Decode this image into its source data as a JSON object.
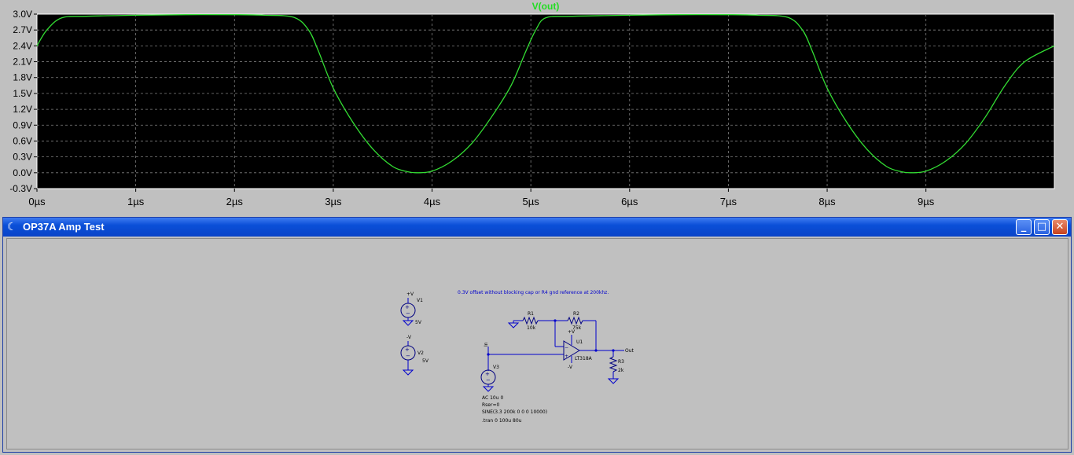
{
  "plot": {
    "trace_name": "V(out)",
    "background": "#000000",
    "trace_color": "#33dd33",
    "y_ticks": [
      "3.0V",
      "2.7V",
      "2.4V",
      "2.1V",
      "1.8V",
      "1.5V",
      "1.2V",
      "0.9V",
      "0.6V",
      "0.3V",
      "0.0V",
      "-0.3V"
    ],
    "x_ticks": [
      "0µs",
      "1µs",
      "2µs",
      "3µs",
      "4µs",
      "5µs",
      "6µs",
      "7µs",
      "8µs",
      "9µs"
    ]
  },
  "chart_data": {
    "type": "line",
    "title": "V(out)",
    "xlim": [
      0,
      10.3
    ],
    "ylim": [
      -0.3,
      3.0
    ],
    "x_unit": "µs",
    "y_unit": "V",
    "grid": true,
    "series": [
      {
        "name": "V(out)",
        "x": [
          0,
          0.1,
          0.25,
          0.5,
          1.0,
          1.5,
          2.0,
          2.3,
          2.6,
          2.75,
          2.85,
          3.0,
          3.2,
          3.4,
          3.6,
          3.75,
          3.85,
          4.0,
          4.2,
          4.4,
          4.6,
          4.8,
          4.95,
          5.05,
          5.15,
          5.4,
          6.0,
          6.5,
          7.0,
          7.3,
          7.6,
          7.75,
          7.85,
          8.0,
          8.2,
          8.4,
          8.6,
          8.75,
          8.85,
          9.0,
          9.2,
          9.4,
          9.6,
          9.8,
          10.0,
          10.3
        ],
        "y": [
          2.4,
          2.7,
          2.93,
          2.96,
          2.98,
          2.99,
          2.99,
          2.98,
          2.94,
          2.7,
          2.3,
          1.6,
          0.95,
          0.45,
          0.12,
          0.02,
          0.0,
          0.03,
          0.22,
          0.55,
          1.05,
          1.65,
          2.3,
          2.7,
          2.93,
          2.96,
          2.98,
          2.99,
          2.99,
          2.98,
          2.94,
          2.7,
          2.3,
          1.6,
          0.95,
          0.45,
          0.12,
          0.02,
          0.0,
          0.03,
          0.22,
          0.55,
          1.05,
          1.65,
          2.1,
          2.4
        ]
      }
    ]
  },
  "window": {
    "title": "OP37A Amp Test",
    "minimize": "_",
    "maximize": "□",
    "close": "✕"
  },
  "schematic": {
    "note": "0.3V offset without blocking cap or R4 gnd reference at 200khz.",
    "v1": {
      "name": "V1",
      "value": "5V",
      "net": "+V"
    },
    "v2": {
      "name": "V2",
      "value": "5V",
      "net": "-V"
    },
    "v3": {
      "name": "V3",
      "lines": [
        "AC 10u 0",
        "Rser=0",
        "SINE(3.3 200k 0 0 0 10000)",
        ".tran 0 100u 80u"
      ]
    },
    "in_label": "In",
    "r1": {
      "name": "R1",
      "value": "10k"
    },
    "r2": {
      "name": "R2",
      "value": "75k"
    },
    "r3": {
      "name": "R3",
      "value": "2k"
    },
    "u1": {
      "name": "U1",
      "part": "LT318A",
      "vp": "+V",
      "vn": "-V"
    },
    "out_label": "Out"
  }
}
